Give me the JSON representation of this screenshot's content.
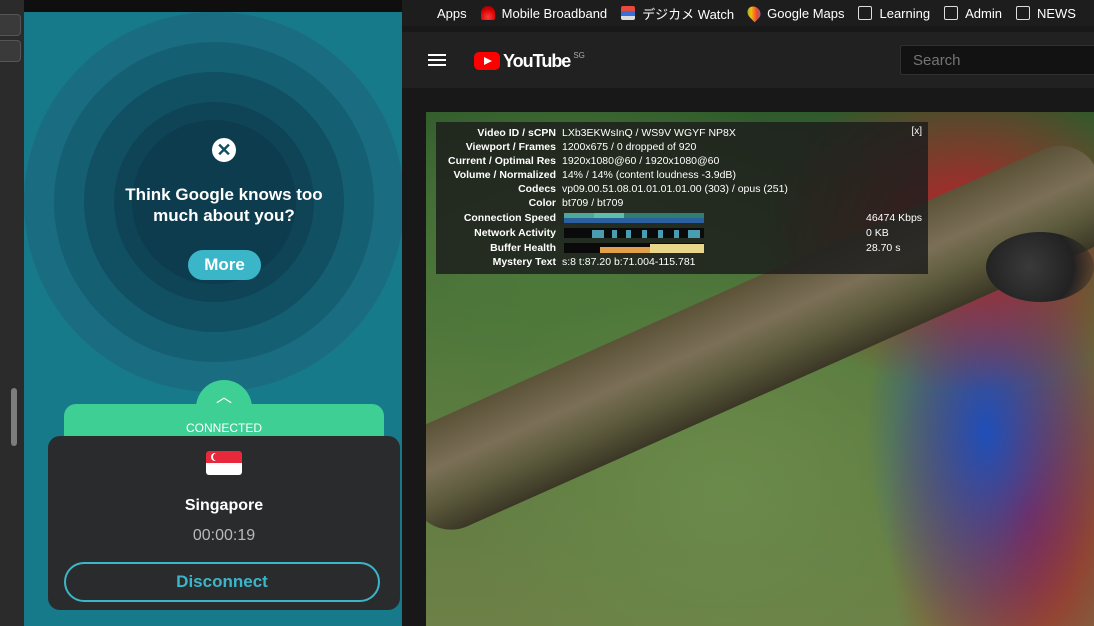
{
  "vpn": {
    "promo_text": "Think Google knows too much about you?",
    "more_label": "More",
    "status": "CONNECTED",
    "country": "Singapore",
    "timer": "00:00:19",
    "disconnect_label": "Disconnect"
  },
  "bookmarks": [
    {
      "label": "Apps",
      "icon": "apps-grid-icon"
    },
    {
      "label": "Mobile Broadband",
      "icon": "huawei-icon"
    },
    {
      "label": "デジカメ Watch",
      "icon": "dc-watch-icon"
    },
    {
      "label": "Google Maps",
      "icon": "maps-pin-icon"
    },
    {
      "label": "Learning",
      "icon": "folder-icon"
    },
    {
      "label": "Admin",
      "icon": "folder-icon"
    },
    {
      "label": "NEWS",
      "icon": "folder-icon"
    }
  ],
  "youtube": {
    "logo_text": "YouTube",
    "region": "SG",
    "search_placeholder": "Search"
  },
  "stats": {
    "close_label": "[x]",
    "rows": [
      {
        "label": "Video ID / sCPN",
        "value": "LXb3EKWsInQ / WS9V WGYF NP8X"
      },
      {
        "label": "Viewport / Frames",
        "value": "1200x675 / 0 dropped of 920"
      },
      {
        "label": "Current / Optimal Res",
        "value": "1920x1080@60 / 1920x1080@60"
      },
      {
        "label": "Volume / Normalized",
        "value": "14% / 14% (content loudness -3.9dB)"
      },
      {
        "label": "Codecs",
        "value": "vp09.00.51.08.01.01.01.01.00 (303) / opus (251)"
      },
      {
        "label": "Color",
        "value": "bt709 / bt709"
      },
      {
        "label": "Connection Speed",
        "value": "46474 Kbps"
      },
      {
        "label": "Network Activity",
        "value": "0 KB"
      },
      {
        "label": "Buffer Health",
        "value": "28.70 s"
      },
      {
        "label": "Mystery Text",
        "value": "s:8 t:87.20 b:71.004-115.781"
      }
    ]
  }
}
